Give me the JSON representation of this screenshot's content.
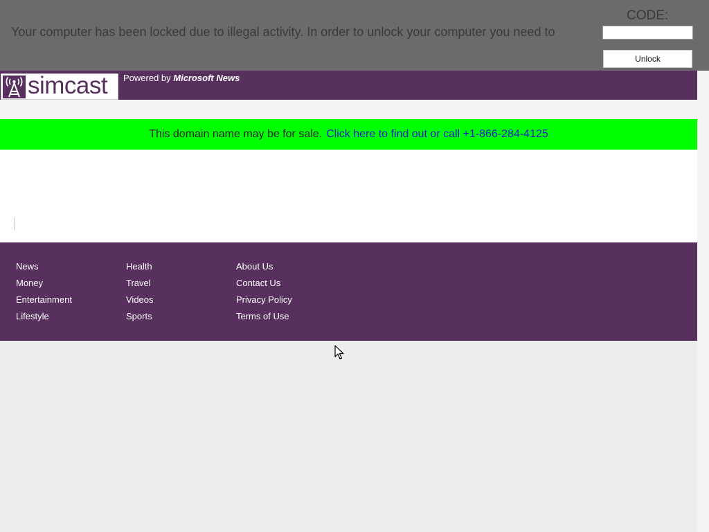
{
  "lock_banner": {
    "message": "Your computer has been locked due to illegal activity. In order to  unlock your computer you need to",
    "code_label": "CODE:",
    "code_value": "",
    "unlock_label": "Unlock"
  },
  "header": {
    "logo_text": "simcast",
    "powered_prefix": "Powered by ",
    "powered_brand": "Microsoft News",
    "brand_color": "#57305e"
  },
  "sale_bar": {
    "text": "This domain name may be for sale.",
    "link": "Click here to find out or call +1-866-284-4125",
    "background": "#00ff00"
  },
  "footer": {
    "col1": [
      "News",
      "Money",
      "Entertainment",
      "Lifestyle"
    ],
    "col2": [
      "Health",
      "Travel",
      "Videos",
      "Sports"
    ],
    "col3": [
      "About Us",
      "Contact Us",
      "Privacy Policy",
      "Terms of Use"
    ]
  },
  "icons": {
    "logo": "radio-tower-icon",
    "cursor": "mouse-pointer-icon"
  }
}
